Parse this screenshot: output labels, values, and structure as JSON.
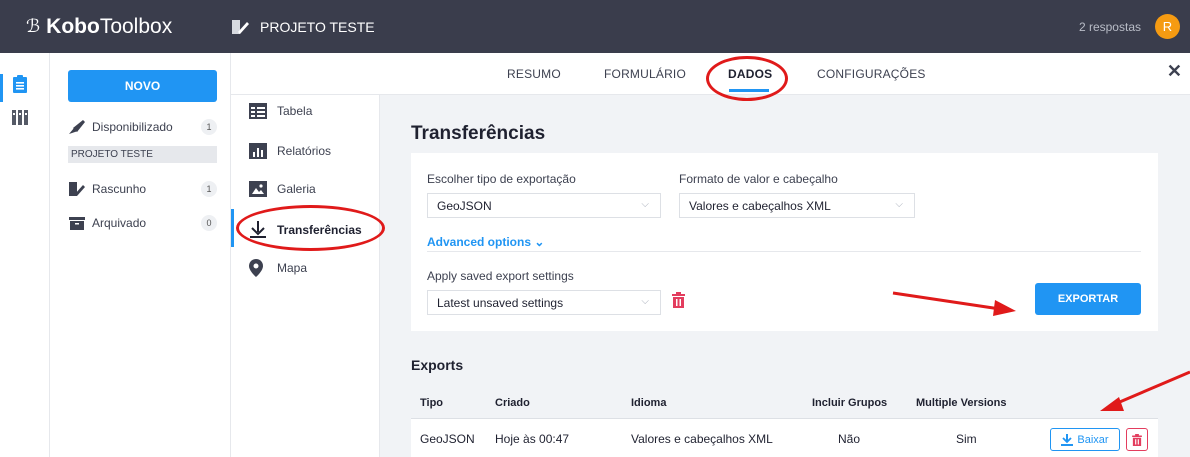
{
  "header": {
    "logo_kobo": "Kobo",
    "logo_toolbox": "Toolbox",
    "project_title": "PROJETO TESTE",
    "responses": "2 respostas",
    "avatar_initial": "R"
  },
  "sidebar": {
    "new_button": "NOVO",
    "items": [
      {
        "label": "Disponibilizado",
        "count": "1",
        "icon": "rocket-icon"
      },
      {
        "label": "Rascunho",
        "count": "1",
        "icon": "draft-icon"
      },
      {
        "label": "Arquivado",
        "count": "0",
        "icon": "archive-icon"
      }
    ],
    "project_sub": "PROJETO TESTE"
  },
  "tabs": [
    "RESUMO",
    "FORMULÁRIO",
    "DADOS",
    "CONFIGURAÇÕES"
  ],
  "active_tab": "DADOS",
  "subnav": [
    {
      "label": "Tabela",
      "icon": "table-icon"
    },
    {
      "label": "Relatórios",
      "icon": "reports-icon"
    },
    {
      "label": "Galeria",
      "icon": "gallery-icon"
    },
    {
      "label": "Transferências",
      "icon": "download-icon"
    },
    {
      "label": "Mapa",
      "icon": "map-pin-icon"
    }
  ],
  "main": {
    "title": "Transferências",
    "export_type_label": "Escolher tipo de exportação",
    "export_type_value": "GeoJSON",
    "format_label": "Formato de valor e cabeçalho",
    "format_value": "Valores e cabeçalhos XML",
    "advanced": "Advanced options",
    "saved_label": "Apply saved export settings",
    "saved_value": "Latest unsaved settings",
    "export_button": "EXPORTAR",
    "exports_title": "Exports",
    "table_headers": [
      "Tipo",
      "Criado",
      "Idioma",
      "Incluir Grupos",
      "Multiple Versions"
    ],
    "rows": [
      {
        "tipo": "GeoJSON",
        "criado": "Hoje às 00:47",
        "idioma": "Valores e cabeçalhos XML",
        "grupos": "Não",
        "versions": "Sim"
      }
    ],
    "download_button": "Baixar"
  },
  "colors": {
    "topbar": "#3a3d4c",
    "accent": "#2095f3",
    "avatar": "#f59b12",
    "danger": "#e33d5e",
    "annotation": "#e01a1a"
  }
}
